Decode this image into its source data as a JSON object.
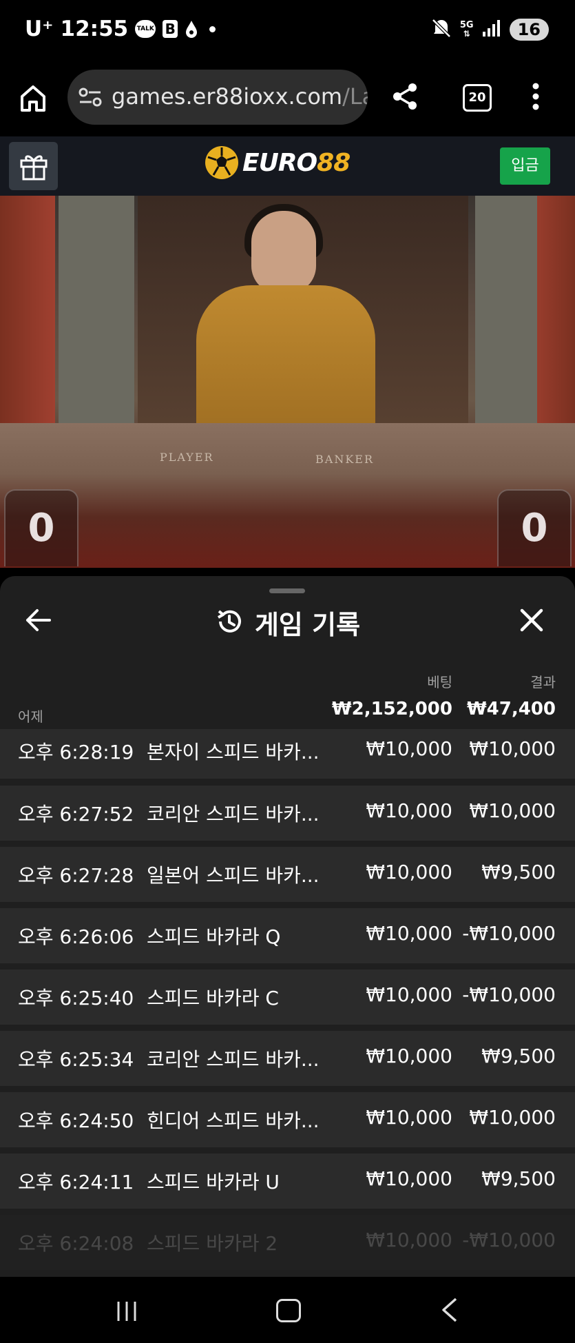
{
  "status_bar": {
    "carrier": "U⁺",
    "time": "12:55",
    "talk_icon_label": "TALK",
    "b_icon_label": "B",
    "network": "5G",
    "battery": "16"
  },
  "browser": {
    "url_main": "games.er88ioxx.com",
    "url_faded": "/Lau",
    "tab_count": "20"
  },
  "site_header": {
    "logo_text_main": "EURO",
    "logo_text_accent": "88",
    "deposit_label": "입금",
    "brand_color": "#f0b323",
    "deposit_color": "#16a34a"
  },
  "live_video": {
    "player_label": "PLAYER",
    "banker_label": "BANKER",
    "player_score": "0",
    "banker_score": "0"
  },
  "history_sheet": {
    "title": "게임 기록",
    "bet_header": "베팅",
    "result_header": "결과",
    "date_group": "어제",
    "total_bet": "₩2,152,000",
    "total_result": "₩47,400",
    "rows": [
      {
        "time": "오후 6:28:19",
        "game": "본자이 스피드 바카...",
        "bet": "₩10,000",
        "result": "₩10,000"
      },
      {
        "time": "오후 6:27:52",
        "game": "코리안 스피드 바카...",
        "bet": "₩10,000",
        "result": "₩10,000"
      },
      {
        "time": "오후 6:27:28",
        "game": "일본어 스피드 바카...",
        "bet": "₩10,000",
        "result": "₩9,500"
      },
      {
        "time": "오후 6:26:06",
        "game": "스피드 바카라 Q",
        "bet": "₩10,000",
        "result": "-₩10,000"
      },
      {
        "time": "오후 6:25:40",
        "game": "스피드 바카라 C",
        "bet": "₩10,000",
        "result": "-₩10,000"
      },
      {
        "time": "오후 6:25:34",
        "game": "코리안 스피드 바카...",
        "bet": "₩10,000",
        "result": "₩9,500"
      },
      {
        "time": "오후 6:24:50",
        "game": "힌디어 스피드 바카...",
        "bet": "₩10,000",
        "result": "₩10,000"
      },
      {
        "time": "오후 6:24:11",
        "game": "스피드 바카라 U",
        "bet": "₩10,000",
        "result": "₩9,500"
      },
      {
        "time": "오후 6:24:08",
        "game": "스피드 바카라 2",
        "bet": "₩10,000",
        "result": "-₩10,000"
      }
    ]
  }
}
